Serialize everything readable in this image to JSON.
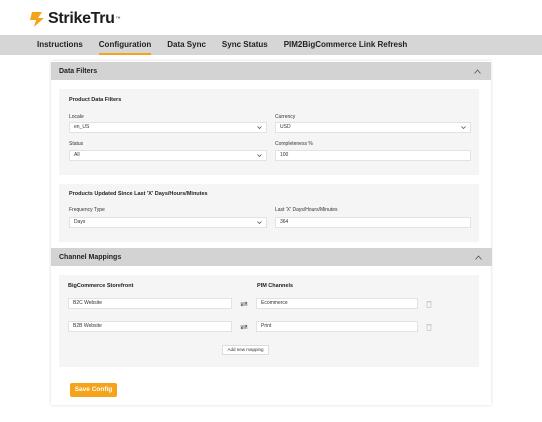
{
  "brand": {
    "name": "StrikeTru",
    "tm": "™",
    "accent": "#f5a31a"
  },
  "nav": {
    "tabs": [
      {
        "label": "Instructions",
        "active": false
      },
      {
        "label": "Configuration",
        "active": true
      },
      {
        "label": "Data Sync",
        "active": false
      },
      {
        "label": "Sync Status",
        "active": false
      },
      {
        "label": "PIM2BigCommerce Link Refresh",
        "active": false
      }
    ]
  },
  "data_filters": {
    "section_title": "Data Filters",
    "product_filters": {
      "title": "Product Data Filters",
      "locale": {
        "label": "Locale",
        "value": "en_US"
      },
      "currency": {
        "label": "Currency",
        "value": "USD"
      },
      "status": {
        "label": "Status",
        "value": "All"
      },
      "completeness": {
        "label": "Completeness %",
        "value": "100"
      }
    },
    "updated_since": {
      "title": "Products Updated Since Last 'X' Days/Hours/Minutes",
      "frequency_type": {
        "label": "Frequency Type",
        "value": "Days"
      },
      "last_x": {
        "label": "Last 'X' Days/Hours/Minutes",
        "value": "364"
      }
    }
  },
  "channel_mappings": {
    "section_title": "Channel Mappings",
    "storefront_header": "BigCommerce Storefront",
    "pim_header": "PIM Channels",
    "rows": [
      {
        "storefront": "B2C Website",
        "pim": "Ecommerce"
      },
      {
        "storefront": "B2B Website",
        "pim": "Print"
      }
    ],
    "add_label": "Add new mapping"
  },
  "save_label": "Save Config",
  "icons": {
    "collapse": "chevron-up-icon",
    "swap": "swap-arrows-icon",
    "delete": "trash-icon",
    "dropdown": "chevron-down-icon"
  }
}
